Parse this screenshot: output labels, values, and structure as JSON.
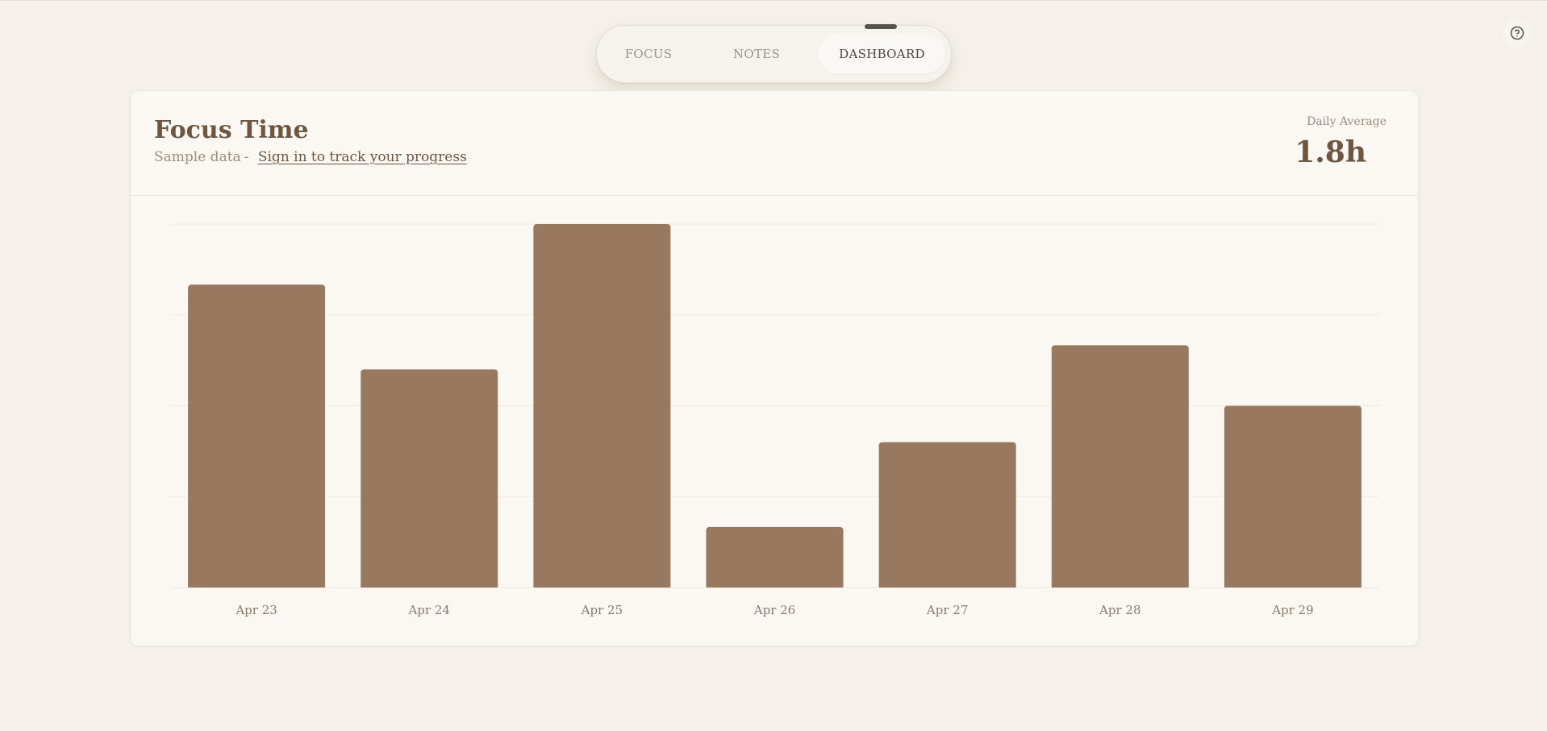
{
  "nav": {
    "tabs": [
      {
        "label": "FOCUS",
        "active": false
      },
      {
        "label": "NOTES",
        "active": false
      },
      {
        "label": "DASHBOARD",
        "active": true
      }
    ]
  },
  "help": {
    "icon": "help-circle-icon"
  },
  "card": {
    "title": "Focus Time",
    "subtitle_prefix": "Sample data",
    "subtitle_separator": "-",
    "signin_link": "Sign in to track your progress",
    "daily_average_label": "Daily Average",
    "daily_average_value": "1.8h"
  },
  "colors": {
    "bar": "#98795f",
    "grid": "#efe9e0",
    "accent_text": "#6e5641",
    "background": "#f5f1ea",
    "card": "#fbf8f3"
  },
  "chart_data": {
    "type": "bar",
    "categories": [
      "Apr 23",
      "Apr 24",
      "Apr 25",
      "Apr 26",
      "Apr 27",
      "Apr 28",
      "Apr 29"
    ],
    "values": [
      2.5,
      1.8,
      3.0,
      0.5,
      1.2,
      2.0,
      1.5
    ],
    "ylim": [
      0,
      3
    ],
    "grid": true,
    "gridlines": 5,
    "title": "",
    "xlabel": "",
    "ylabel": ""
  }
}
